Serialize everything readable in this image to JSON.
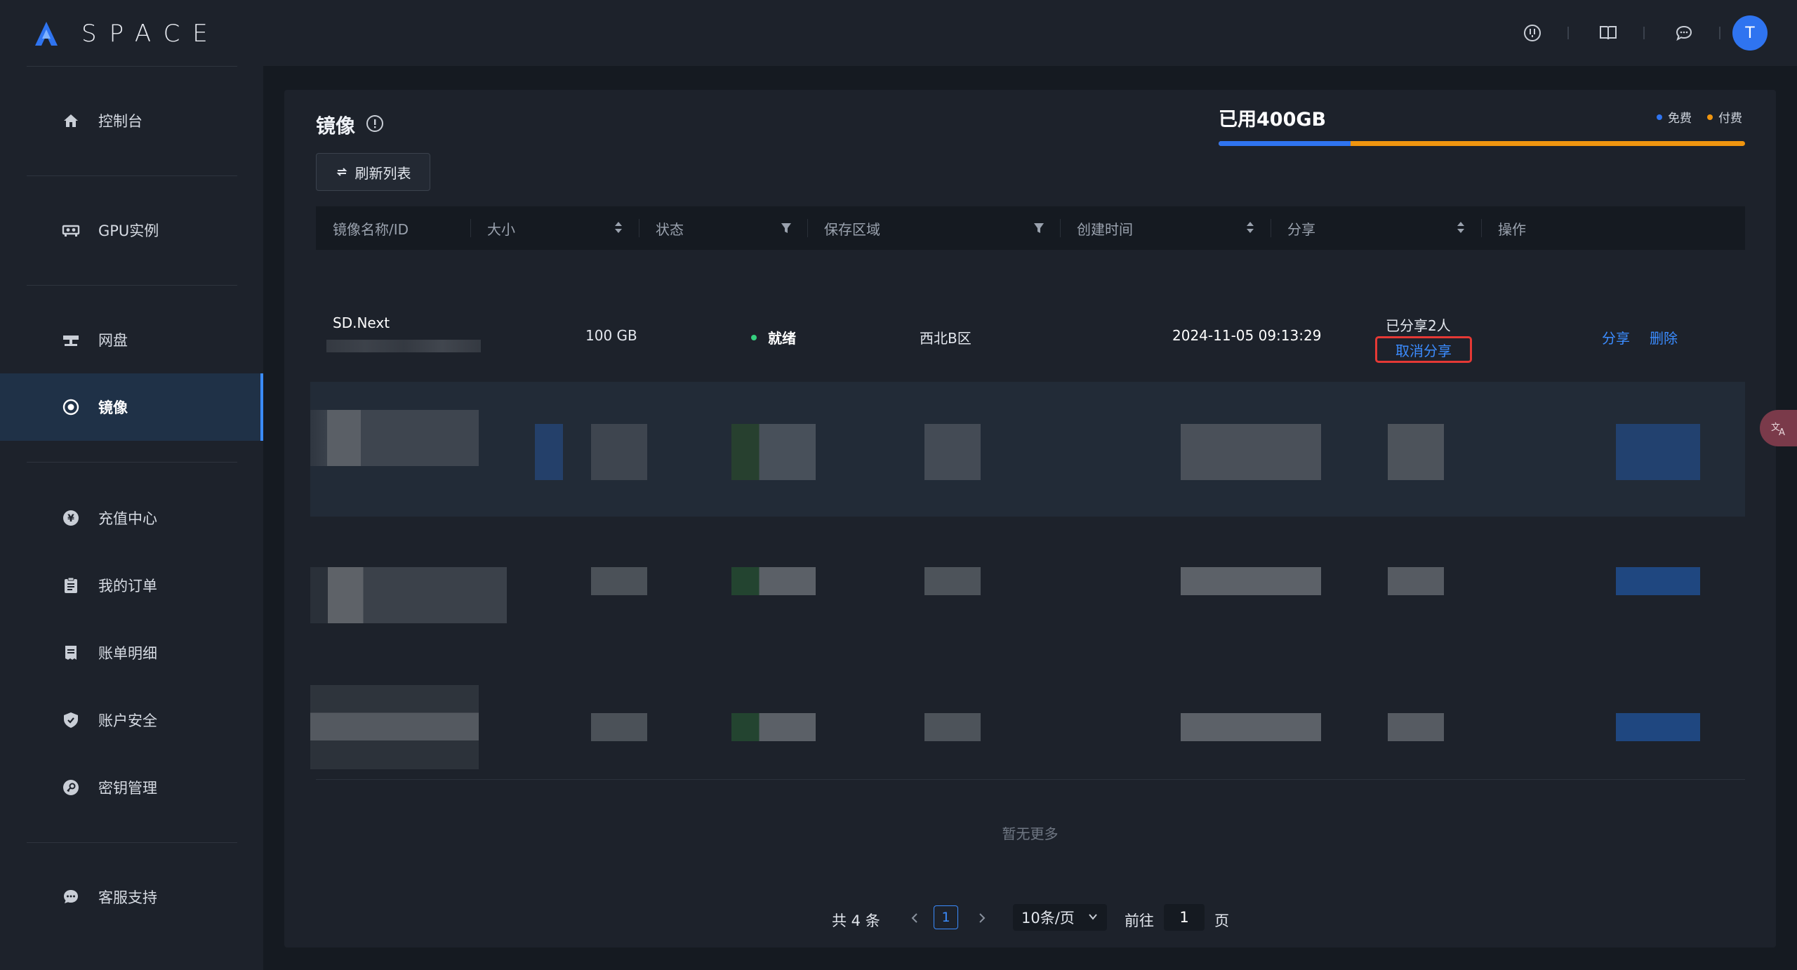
{
  "brand": {
    "name": "SPACE"
  },
  "sidebar": {
    "items": [
      {
        "label": "控制台",
        "icon": "home-icon"
      },
      {
        "label": "GPU实例",
        "icon": "gpu-icon"
      },
      {
        "label": "网盘",
        "icon": "cloud-drive-icon"
      },
      {
        "label": "镜像",
        "icon": "image-icon",
        "active": true
      },
      {
        "label": "充值中心",
        "icon": "yen-icon"
      },
      {
        "label": "我的订单",
        "icon": "order-icon"
      },
      {
        "label": "账单明细",
        "icon": "bill-icon"
      },
      {
        "label": "账户安全",
        "icon": "shield-icon"
      },
      {
        "label": "密钥管理",
        "icon": "key-icon"
      },
      {
        "label": "客服支持",
        "icon": "chat-icon"
      }
    ]
  },
  "header": {
    "avatar_letter": "T"
  },
  "page": {
    "title": "镜像",
    "refresh_label": "刷新列表"
  },
  "usage": {
    "label": "已用400GB",
    "legend_free": "免费",
    "legend_paid": "付费",
    "free_fraction": 0.25,
    "free_color": "#2f74f0",
    "paid_color": "#f0950f"
  },
  "table": {
    "columns": [
      "镜像名称/ID",
      "大小",
      "状态",
      "保存区域",
      "创建时间",
      "分享",
      "操作"
    ],
    "rows": [
      {
        "name": "SD.Next",
        "size": "100 GB",
        "status": "就绪",
        "region": "西北B区",
        "created": "2024-11-05 09:13:29",
        "shared": "已分享2人",
        "unshare": "取消分享",
        "action_share": "分享",
        "action_delete": "删除"
      }
    ],
    "empty_more": "暂无更多"
  },
  "pagination": {
    "total": "共 4 条",
    "current_page": "1",
    "page_size": "10条/页",
    "goto_label": "前往",
    "goto_value": "1",
    "goto_unit": "页"
  },
  "colors": {
    "accent": "#3b8cff",
    "status_ready": "#35d07f",
    "highlight": "#e53935"
  }
}
